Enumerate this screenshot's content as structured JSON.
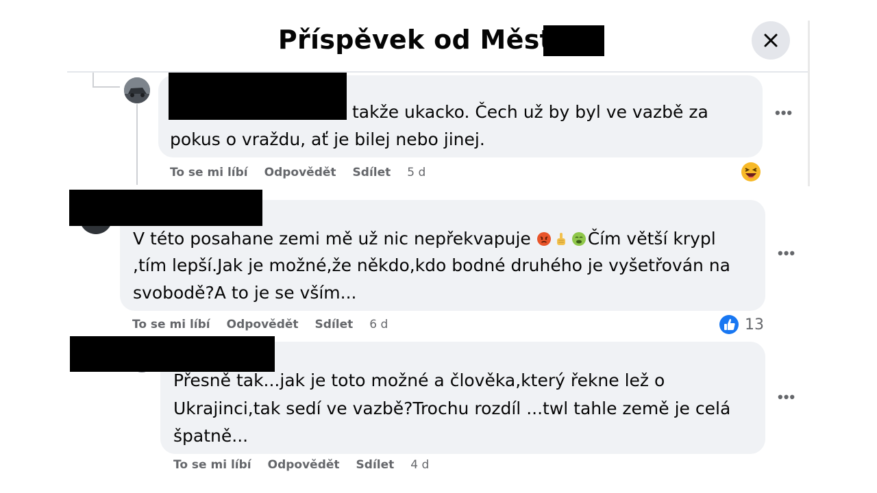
{
  "header": {
    "title": "Příspěvek od Město P"
  },
  "comments": [
    {
      "text_line1": "takže ukacko. Čech už by byl ve vazbě za",
      "text_line2": "pokus o vraždu, ať je bilej nebo jinej.",
      "actions": {
        "like": "To se mi líbí",
        "reply": "Odpovědět",
        "share": "Sdílet",
        "time": "5 d"
      },
      "reaction_icon": "laughing-emoji-icon"
    },
    {
      "text_line1a": "V této posahane zemi mě už nic nepřekvapuje ",
      "text_line1b": "Čím větší krypl",
      "text_line2": ",tím lepší.Jak je možné,že někdo,kdo bodné druhého je vyšetřován na",
      "text_line3": "svobodě?A to je se vším...",
      "emojis": [
        "angry-face-icon",
        "pointing-up-icon",
        "nauseated-face-icon"
      ],
      "actions": {
        "like": "To se mi líbí",
        "reply": "Odpovědět",
        "share": "Sdílet",
        "time": "6 d"
      },
      "reaction_icon": "like-thumb-icon",
      "reaction_count": "13"
    },
    {
      "text_line1": "Přesně tak...jak je toto možné a člověka,který řekne lež o",
      "text_line2": "Ukrajinci,tak sedí ve vazbě?Trochu rozdíl ...twl tahle země je celá",
      "text_line3": "špatně...",
      "actions": {
        "like": "To se mi líbí",
        "reply": "Odpovědět",
        "share": "Sdílet",
        "time": "4 d"
      }
    }
  ],
  "more_label": "•••",
  "colors": {
    "bubble": "#f0f2f5",
    "muted": "#65676b",
    "like_blue": "#1877f2",
    "redaction": "#000000"
  }
}
